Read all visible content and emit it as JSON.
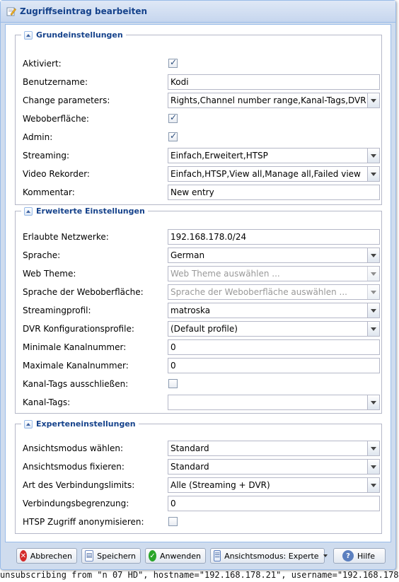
{
  "window": {
    "title": "Zugriffseintrag bearbeiten"
  },
  "background_text": "unsubscribing from \"n 07 HD\", hostname=\"192.168.178.21\", username=\"192.168.178.",
  "sections": {
    "basic": {
      "legend": "Grundeinstellungen",
      "enabled_label": "Aktiviert:",
      "enabled_checked": true,
      "username_label": "Benutzername:",
      "username_value": "Kodi",
      "change_label": "Change parameters:",
      "change_value": "Rights,Channel number range,Kanal-Tags,DVR con",
      "webui_label": "Weboberfläche:",
      "webui_checked": true,
      "admin_label": "Admin:",
      "admin_checked": true,
      "streaming_label": "Streaming:",
      "streaming_value": "Einfach,Erweitert,HTSP",
      "dvr_label": "Video Rekorder:",
      "dvr_value": "Einfach,HTSP,View all,Manage all,Failed view",
      "comment_label": "Kommentar:",
      "comment_value": "New entry"
    },
    "advanced": {
      "legend": "Erweiterte Einstellungen",
      "networks_label": "Erlaubte Netzwerke:",
      "networks_value": "192.168.178.0/24",
      "language_label": "Sprache:",
      "language_value": "German",
      "theme_label": "Web Theme:",
      "theme_placeholder": "Web Theme auswählen ...",
      "uilang_label": "Sprache der Weboberfläche:",
      "uilang_placeholder": "Sprache der Weboberfläche auswählen ...",
      "profile_label": "Streamingprofil:",
      "profile_value": "matroska",
      "dvrprofile_label": "DVR Konfigurationsprofile:",
      "dvrprofile_value": "(Default profile)",
      "minchan_label": "Minimale Kanalnummer:",
      "minchan_value": "0",
      "maxchan_label": "Maximale Kanalnummer:",
      "maxchan_value": "0",
      "excludetags_label": "Kanal-Tags ausschließen:",
      "excludetags_checked": false,
      "tags_label": "Kanal-Tags:",
      "tags_value": ""
    },
    "expert": {
      "legend": "Experteneinstellungen",
      "viewmode_label": "Ansichtsmodus wählen:",
      "viewmode_value": "Standard",
      "viewfix_label": "Ansichtsmodus fixieren:",
      "viewfix_value": "Standard",
      "connlimit_type_label": "Art des Verbindungslimits:",
      "connlimit_type_value": "Alle (Streaming + DVR)",
      "connlimit_label": "Verbindungsbegrenzung:",
      "connlimit_value": "0",
      "htsp_anon_label": "HTSP Zugriff anonymisieren:",
      "htsp_anon_checked": false
    }
  },
  "buttons": {
    "cancel": "Abbrechen",
    "save": "Speichern",
    "apply": "Anwenden",
    "viewmode": "Ansichtsmodus: Experte",
    "help": "Hilfe"
  },
  "colors": {
    "window_border": "#99bbe8",
    "title_text": "#15428b",
    "window_bg": "#cfdcee"
  }
}
